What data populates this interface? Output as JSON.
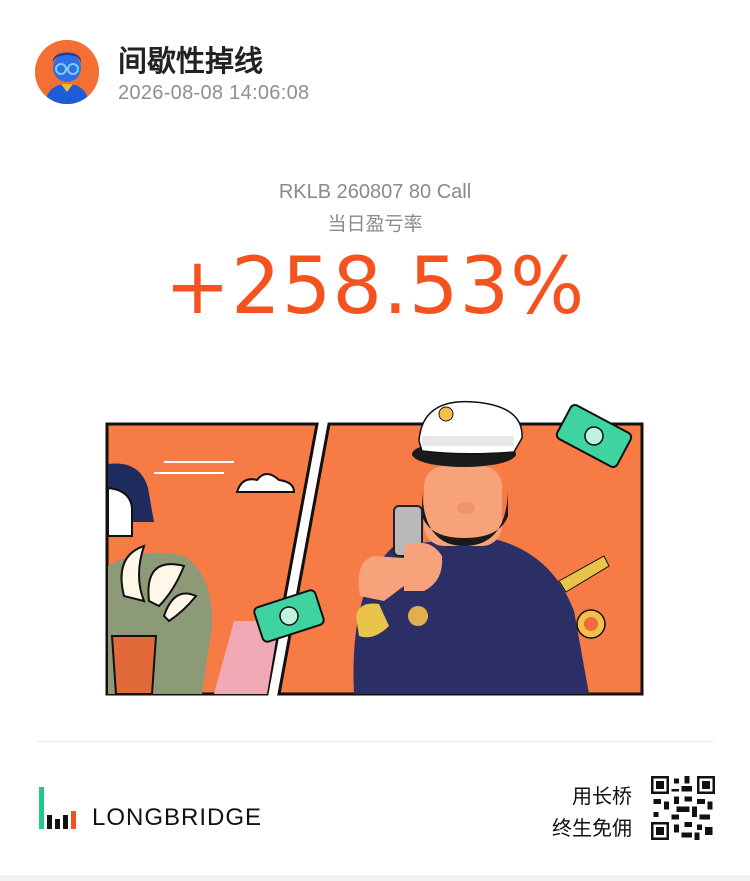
{
  "header": {
    "username": "间歇性掉线",
    "timestamp": "2026-08-08 14:06:08"
  },
  "trade": {
    "contract": "RKLB 260807 80 Call",
    "metric_label": "当日盈亏率",
    "pnl_percent": "+258.53%"
  },
  "footer": {
    "brand_name": "LONGBRIDGE",
    "promo_line1": "用长桥",
    "promo_line2": "终生免佣"
  },
  "colors": {
    "accent_orange": "#f4531f",
    "illustration_orange": "#f77b45",
    "money_green": "#3fd3a1",
    "uniform_navy": "#2b2f66"
  },
  "icons": {
    "avatar": "avatar-icon",
    "brand": "longbridge-logo-icon",
    "qr": "qr-code-icon"
  }
}
